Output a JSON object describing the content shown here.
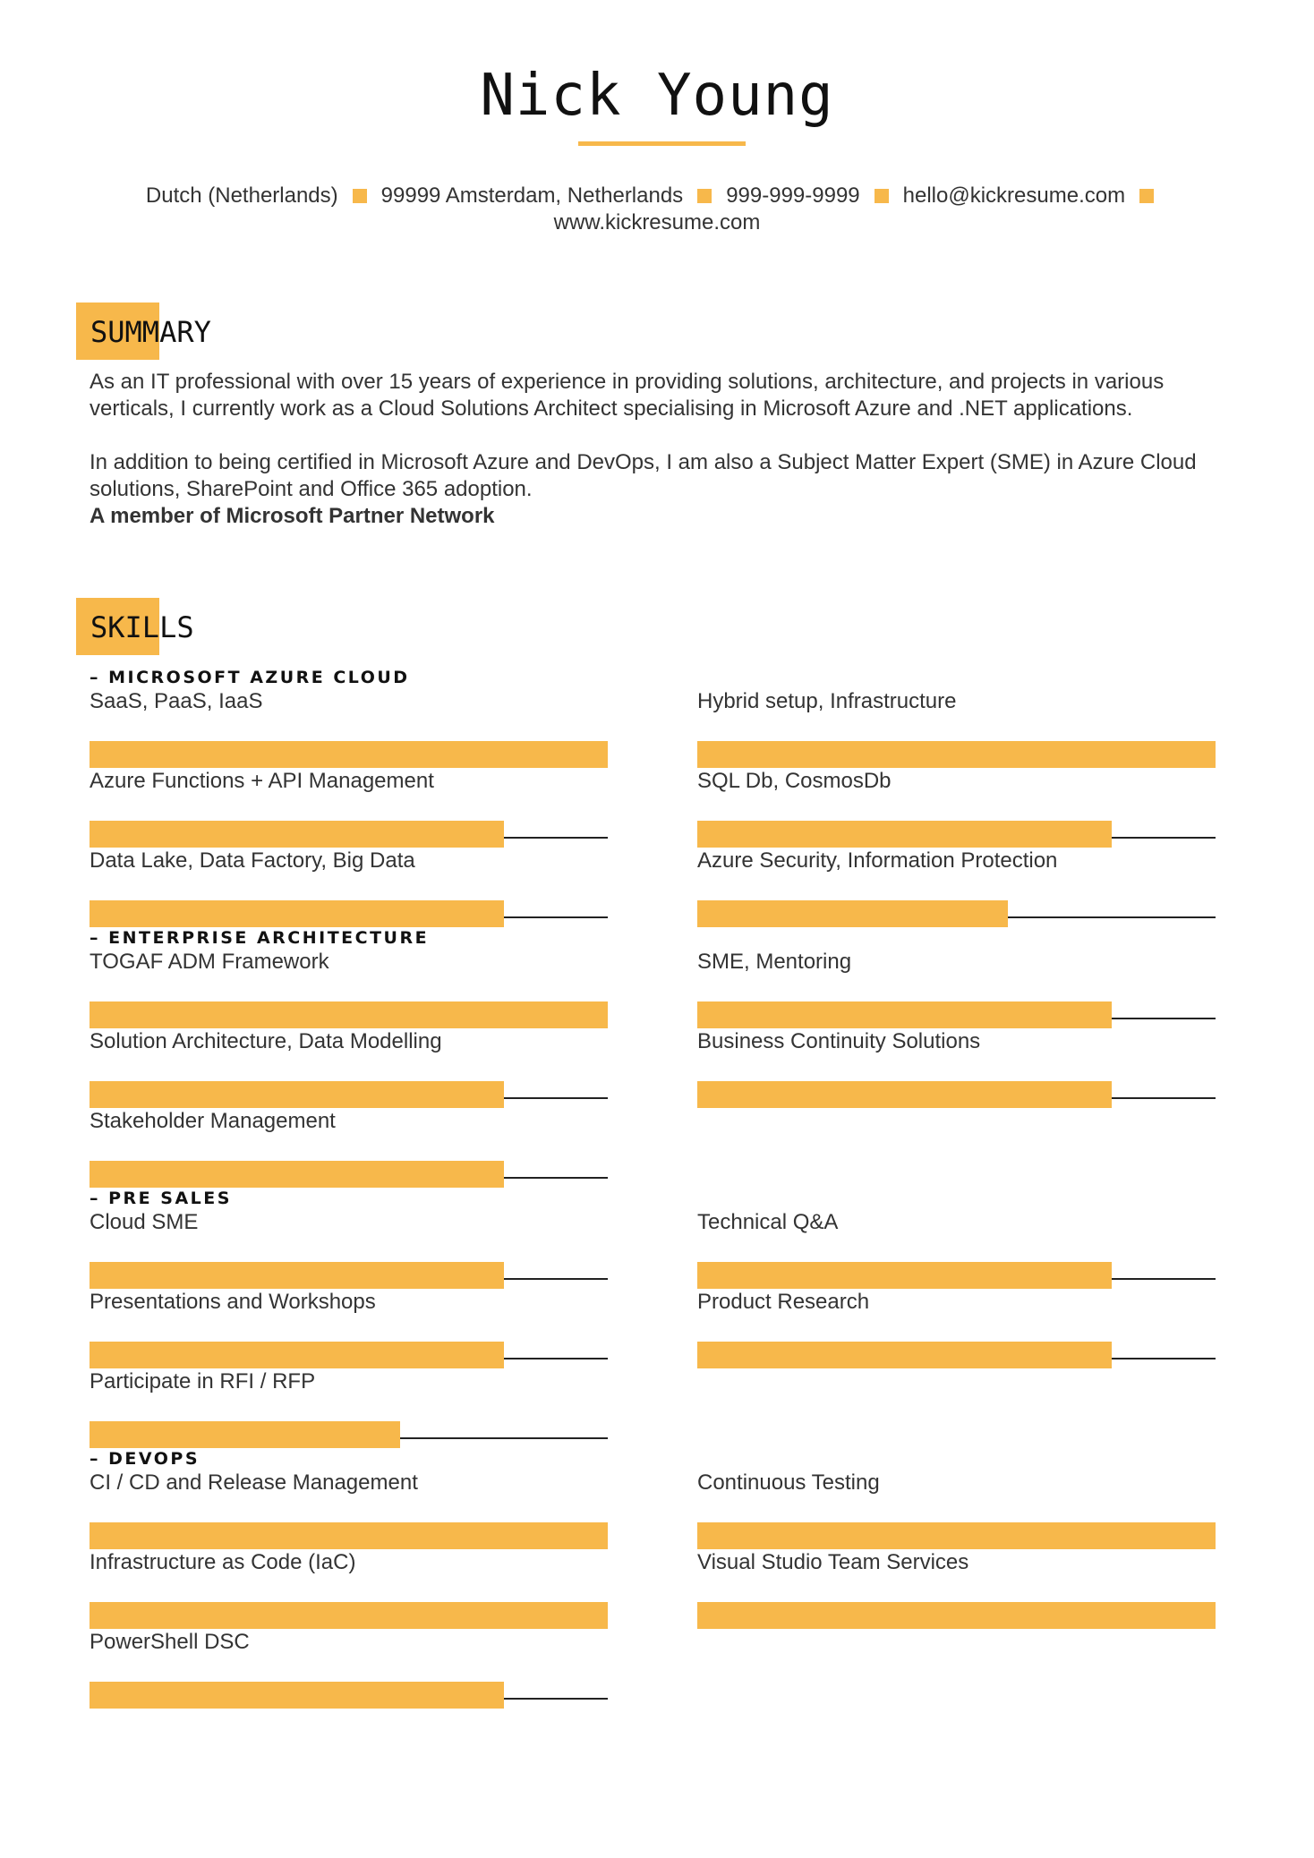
{
  "header": {
    "name": "Nick Young",
    "contact_items": [
      "Dutch (Netherlands)",
      "99999 Amsterdam, Netherlands",
      "999-999-9999",
      "hello@kickresume.com"
    ],
    "website": "www.kickresume.com",
    "accent_color": "#f7b84b"
  },
  "summary": {
    "title": "SUMMARY",
    "paragraph1": "As an IT professional with over 15 years of experience in providing solutions, architecture, and projects in various verticals, I currently work as a Cloud Solutions Architect specialising in Microsoft Azure and .NET applications.",
    "paragraph2": "In addition to being certified in Microsoft Azure and DevOps, I am also a Subject Matter Expert (SME) in Azure Cloud solutions, SharePoint and Office 365 adoption.",
    "highlight": "A member of Microsoft Partner Network"
  },
  "skills": {
    "title": "SKILLS",
    "groups": [
      {
        "name": "– MICROSOFT AZURE CLOUD",
        "items": [
          {
            "label": "SaaS, PaaS, IaaS",
            "level": 1.0
          },
          {
            "label": "Hybrid setup, Infrastructure",
            "level": 1.0
          },
          {
            "label": "Azure Functions + API Management",
            "level": 0.8
          },
          {
            "label": "SQL Db, CosmosDb",
            "level": 0.8
          },
          {
            "label": "Data Lake, Data Factory, Big Data",
            "level": 0.8
          },
          {
            "label": "Azure Security, Information Protection",
            "level": 0.6
          }
        ]
      },
      {
        "name": "– ENTERPRISE ARCHITECTURE",
        "items": [
          {
            "label": "TOGAF ADM Framework",
            "level": 1.0
          },
          {
            "label": "SME, Mentoring",
            "level": 0.8
          },
          {
            "label": "Solution Architecture, Data Modelling",
            "level": 0.8
          },
          {
            "label": "Business Continuity Solutions",
            "level": 0.8
          },
          {
            "label": "Stakeholder Management",
            "level": 0.8
          }
        ]
      },
      {
        "name": "– PRE SALES",
        "items": [
          {
            "label": "Cloud SME",
            "level": 0.8
          },
          {
            "label": "Technical Q&A",
            "level": 0.8
          },
          {
            "label": "Presentations and Workshops",
            "level": 0.8
          },
          {
            "label": "Product Research",
            "level": 0.8
          },
          {
            "label": "Participate in RFI / RFP",
            "level": 0.6
          }
        ]
      },
      {
        "name": "– DEVOPS",
        "items": [
          {
            "label": "CI / CD and Release Management",
            "level": 1.0
          },
          {
            "label": "Continuous Testing",
            "level": 1.0
          },
          {
            "label": "Infrastructure as Code (IaC)",
            "level": 1.0
          },
          {
            "label": "Visual Studio Team Services",
            "level": 1.0
          },
          {
            "label": "PowerShell DSC",
            "level": 0.8
          }
        ]
      }
    ]
  }
}
